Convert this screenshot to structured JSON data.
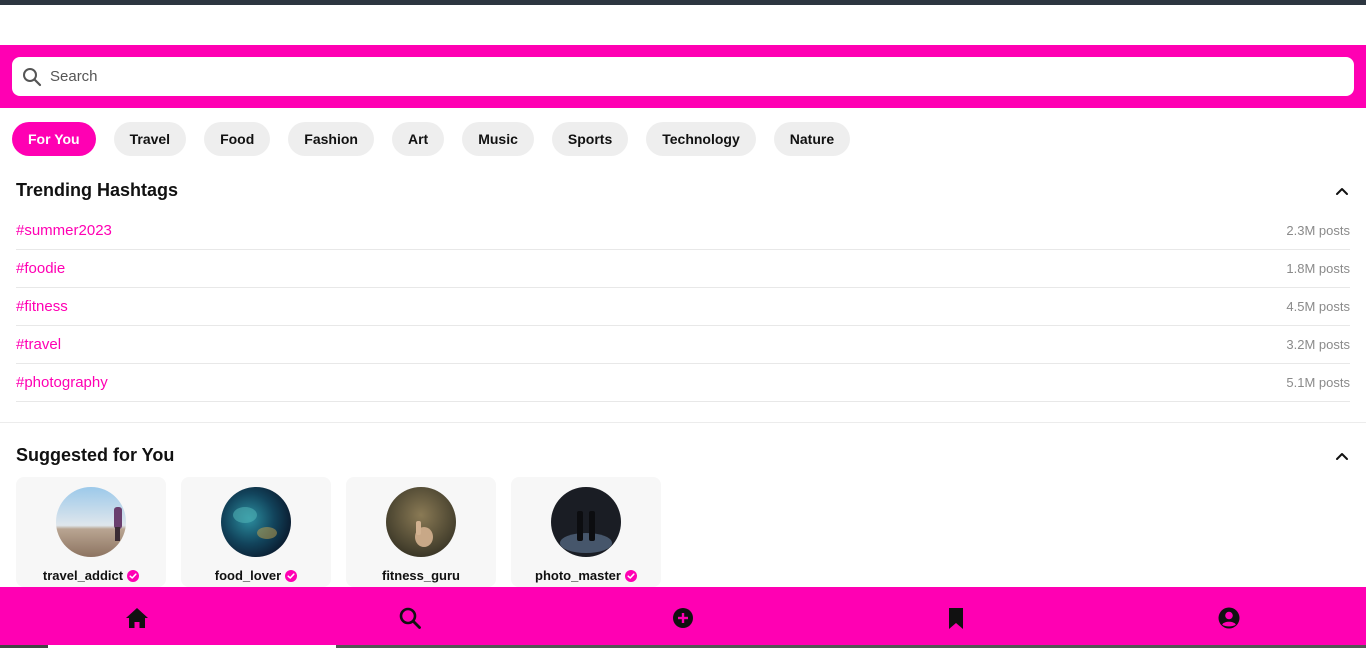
{
  "search": {
    "placeholder": "Search"
  },
  "categories": [
    "For You",
    "Travel",
    "Food",
    "Fashion",
    "Art",
    "Music",
    "Sports",
    "Technology",
    "Nature"
  ],
  "trending": {
    "title": "Trending Hashtags",
    "items": [
      {
        "tag": "#summer2023",
        "count": "2.3M posts"
      },
      {
        "tag": "#foodie",
        "count": "1.8M posts"
      },
      {
        "tag": "#fitness",
        "count": "4.5M posts"
      },
      {
        "tag": "#travel",
        "count": "3.2M posts"
      },
      {
        "tag": "#photography",
        "count": "5.1M posts"
      }
    ]
  },
  "suggested": {
    "title": "Suggested for You",
    "users": [
      {
        "name": "travel_addict",
        "verified": true
      },
      {
        "name": "food_lover",
        "verified": true
      },
      {
        "name": "fitness_guru",
        "verified": false
      },
      {
        "name": "photo_master",
        "verified": true
      }
    ]
  },
  "bottom_nav": [
    "home-icon",
    "search-icon",
    "add-icon",
    "bookmark-icon",
    "profile-icon"
  ],
  "colors": {
    "accent": "#ff00b3",
    "chip": "#eeeeee",
    "count": "#8a8a8a"
  }
}
